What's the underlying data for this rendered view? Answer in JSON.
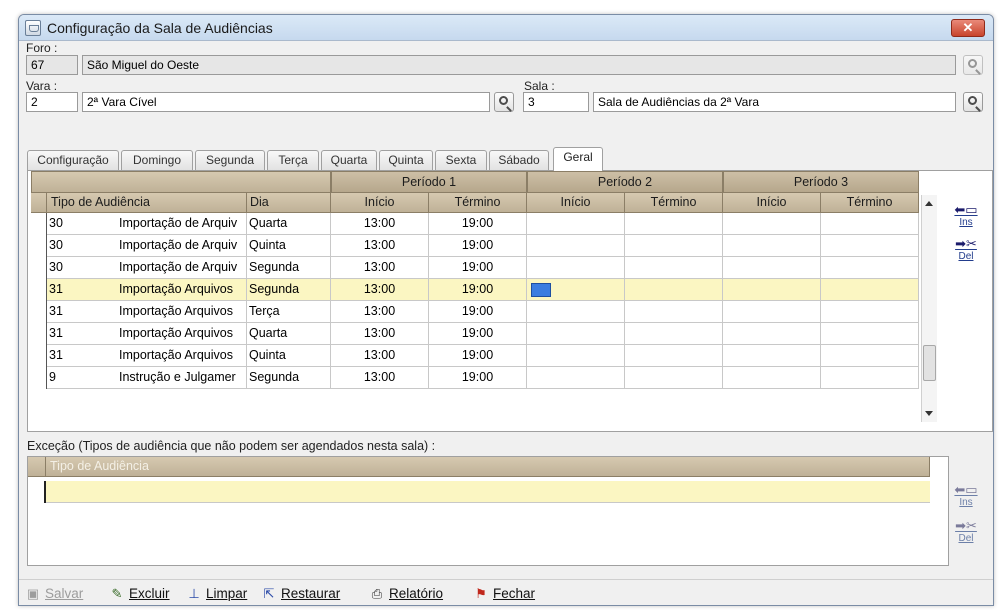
{
  "window": {
    "title": "Configuração da Sala de Audiências",
    "close_label": "✕"
  },
  "foro": {
    "label": "Foro :",
    "code": "67",
    "name": "São Miguel do Oeste"
  },
  "vara": {
    "label": "Vara :",
    "code": "2",
    "name": "2ª Vara Cível"
  },
  "sala": {
    "label": "Sala :",
    "code": "3",
    "name": "Sala de Audiências da 2ª Vara"
  },
  "tabs": [
    {
      "label": "Configuração"
    },
    {
      "label": "Domingo"
    },
    {
      "label": "Segunda"
    },
    {
      "label": "Terça"
    },
    {
      "label": "Quarta"
    },
    {
      "label": "Quinta"
    },
    {
      "label": "Sexta"
    },
    {
      "label": "Sábado"
    },
    {
      "label": "Geral"
    }
  ],
  "active_tab": "Geral",
  "grid": {
    "periods": [
      "Período 1",
      "Período 2",
      "Período 3"
    ],
    "columns": {
      "tipo": "Tipo de Audiência",
      "dia": "Dia",
      "inicio": "Início",
      "termino": "Término"
    },
    "rows": [
      {
        "code": "30",
        "tipo": "Importação de Arquiv",
        "dia": "Quarta",
        "p1_ini": "13:00",
        "p1_fim": "19:00",
        "p2_ini": "",
        "p2_fim": "",
        "p3_ini": "",
        "p3_fim": ""
      },
      {
        "code": "30",
        "tipo": "Importação de Arquiv",
        "dia": "Quinta",
        "p1_ini": "13:00",
        "p1_fim": "19:00",
        "p2_ini": "",
        "p2_fim": "",
        "p3_ini": "",
        "p3_fim": ""
      },
      {
        "code": "30",
        "tipo": "Importação de Arquiv",
        "dia": "Segunda",
        "p1_ini": "13:00",
        "p1_fim": "19:00",
        "p2_ini": "",
        "p2_fim": "",
        "p3_ini": "",
        "p3_fim": ""
      },
      {
        "code": "31",
        "tipo": "Importação Arquivos",
        "dia": "Segunda",
        "p1_ini": "13:00",
        "p1_fim": "19:00",
        "p2_ini": "",
        "p2_fim": "",
        "p3_ini": "",
        "p3_fim": ""
      },
      {
        "code": "31",
        "tipo": "Importação Arquivos",
        "dia": "Terça",
        "p1_ini": "13:00",
        "p1_fim": "19:00",
        "p2_ini": "",
        "p2_fim": "",
        "p3_ini": "",
        "p3_fim": ""
      },
      {
        "code": "31",
        "tipo": "Importação Arquivos",
        "dia": "Quarta",
        "p1_ini": "13:00",
        "p1_fim": "19:00",
        "p2_ini": "",
        "p2_fim": "",
        "p3_ini": "",
        "p3_fim": ""
      },
      {
        "code": "31",
        "tipo": "Importação Arquivos",
        "dia": "Quinta",
        "p1_ini": "13:00",
        "p1_fim": "19:00",
        "p2_ini": "",
        "p2_fim": "",
        "p3_ini": "",
        "p3_fim": ""
      },
      {
        "code": "9",
        "tipo": "Instrução e Julgamer",
        "dia": "Segunda",
        "p1_ini": "13:00",
        "p1_fim": "19:00",
        "p2_ini": "",
        "p2_fim": "",
        "p3_ini": "",
        "p3_fim": ""
      }
    ],
    "selected_row": 3
  },
  "side_buttons": {
    "ins": "Ins",
    "del": "Del"
  },
  "excecao": {
    "label": "Exceção (Tipos de audiência que não podem ser agendados nesta sala) :",
    "column": "Tipo de Audiência"
  },
  "toolbar": {
    "salvar": {
      "label": "Salvar",
      "icon": "save-icon"
    },
    "excluir": {
      "label": "Excluir",
      "icon": "delete-icon"
    },
    "limpar": {
      "label": "Limpar",
      "icon": "clear-icon"
    },
    "restaurar": {
      "label": "Restaurar",
      "icon": "restore-icon"
    },
    "relatorio": {
      "label": "Relatório",
      "icon": "print-icon"
    },
    "fechar": {
      "label": "Fechar",
      "icon": "flag-icon"
    }
  },
  "colors": {
    "header": "#c2b49a",
    "selected_row": "#fbf6c2",
    "close": "#c8442c"
  }
}
